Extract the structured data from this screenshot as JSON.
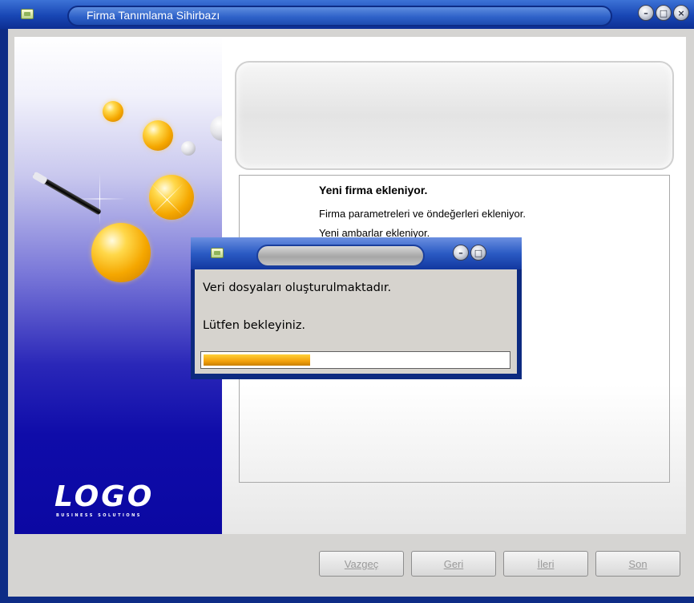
{
  "window": {
    "title": "Firma Tanımlama Sihirbazı",
    "controls": [
      "minimize",
      "maximize",
      "close"
    ]
  },
  "banner": {
    "logo": "LOGO",
    "logo_sub": "BUSINESS SOLUTIONS"
  },
  "status": {
    "title": "Yeni firma ekleniyor.",
    "lines": [
      "Firma parametreleri ve öndeğerleri ekleniyor.",
      "Yeni ambarlar ekleniyor."
    ]
  },
  "buttons": {
    "cancel": "Vazgeç",
    "back": "Geri",
    "next": "İleri",
    "finish": "Son"
  },
  "dialog": {
    "message": "Veri dosyaları oluşturulmaktadır.",
    "wait": "Lütfen bekleyiniz.",
    "progress": 0.35,
    "progress_color": "#f3a00b"
  },
  "colors": {
    "titlebar": "#1846b4",
    "client_bg": "#d5d4d2",
    "banner_deep": "#0f0ca9"
  }
}
